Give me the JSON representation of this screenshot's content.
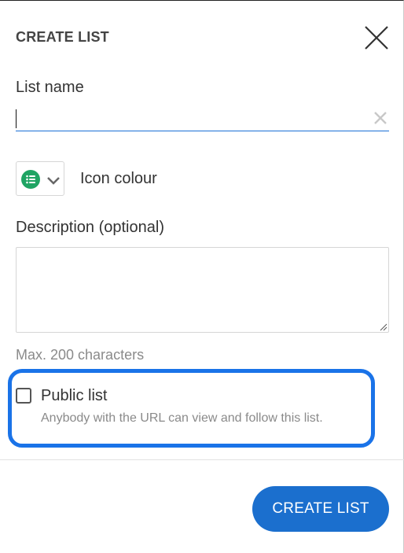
{
  "dialog": {
    "title": "CREATE LIST",
    "close_icon": "close-icon"
  },
  "name_field": {
    "label": "List name",
    "value": "",
    "clear_icon": "clear-icon"
  },
  "icon_colour": {
    "label": "Icon colour",
    "selected_color": "#1fa463",
    "icon": "list-icon",
    "chevron_icon": "chevron-down-icon"
  },
  "description": {
    "label": "Description (optional)",
    "value": "",
    "hint": "Max. 200 characters"
  },
  "public_list": {
    "label": "Public list",
    "hint": "Anybody with the URL can view and follow this list.",
    "checked": false,
    "highlight_color": "#1a73e8"
  },
  "footer": {
    "create_label": "CREATE LIST",
    "create_color": "#1b6fce"
  }
}
